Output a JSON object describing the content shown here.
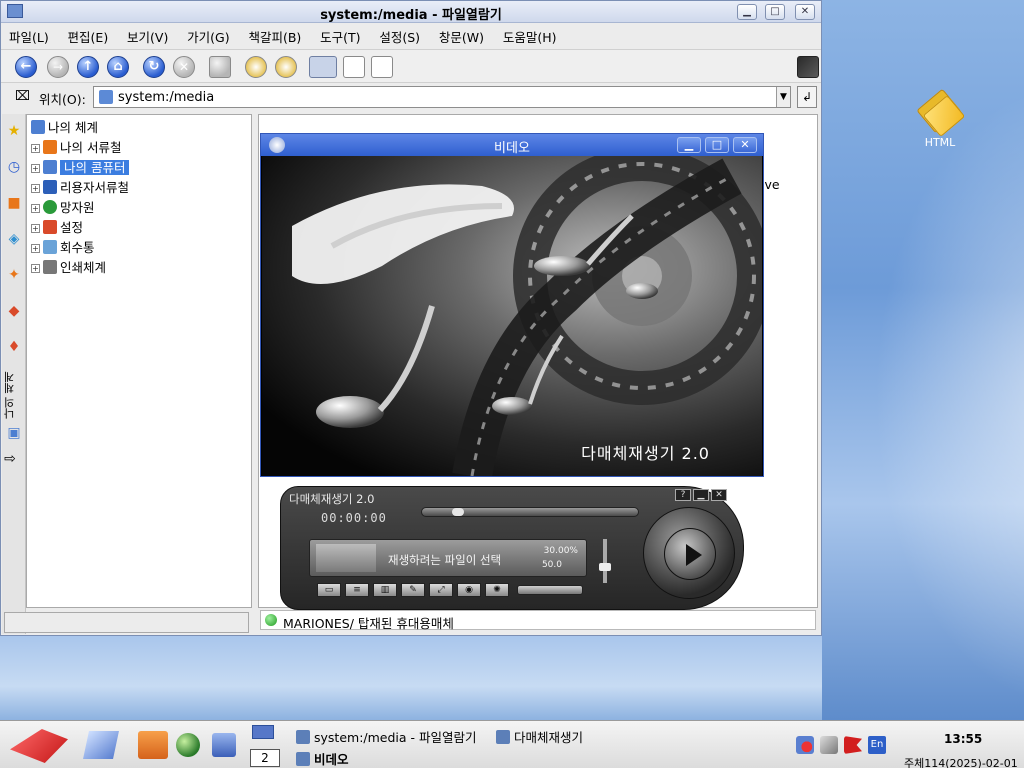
{
  "desktop": {
    "icon_label": "HTML"
  },
  "window": {
    "title": "system:/media - 파일열람기",
    "menu": [
      "파일(L)",
      "편집(E)",
      "보기(V)",
      "가기(G)",
      "책갈피(B)",
      "도구(T)",
      "설정(S)",
      "창문(W)",
      "도움말(H)"
    ],
    "location_label": "위치(O):",
    "location_value": "system:/media",
    "sidebar_tab_label": "나의 체계",
    "tree": [
      {
        "label": "나의 체계",
        "expander": "",
        "selected": false,
        "icon_color": "#4d7fd1"
      },
      {
        "label": "나의 서류철",
        "expander": "+",
        "selected": false,
        "icon_color": "#e8761a"
      },
      {
        "label": "나의 콤퓨터",
        "expander": "+",
        "selected": true,
        "icon_color": "#4d7fd1"
      },
      {
        "label": "리용자서류철",
        "expander": "+",
        "selected": false,
        "icon_color": "#2c5fb8"
      },
      {
        "label": "망자원",
        "expander": "+",
        "selected": false,
        "icon_color": "#2a9a3a"
      },
      {
        "label": "설정",
        "expander": "+",
        "selected": false,
        "icon_color": "#d94a2a"
      },
      {
        "label": "회수통",
        "expander": "+",
        "selected": false,
        "icon_color": "#6aa3d8"
      },
      {
        "label": "인쇄체계",
        "expander": "+",
        "selected": false,
        "icon_color": "#777777"
      }
    ],
    "status_text": "MARIONES/  탑재된 휴대용매체",
    "pane_fragment": "ive"
  },
  "video": {
    "title": "비데오",
    "caption": "다매체재생기 2.0"
  },
  "player": {
    "title": "다매체재생기 2.0",
    "time": "00:00:00",
    "message": "재생하려는 파일이 선택",
    "vol_pct": "30.00%",
    "balance": "50.0"
  },
  "taskbar": {
    "tasks": [
      "system:/media - 파일열람기",
      "다매체재생기",
      "비데오"
    ],
    "desktop_number": "2",
    "time": "13:55",
    "date": "주체114(2025)-02-01",
    "lang": "En"
  },
  "colors": {
    "selection": "#3b7de0",
    "title_blue": "#2f5fcf"
  }
}
